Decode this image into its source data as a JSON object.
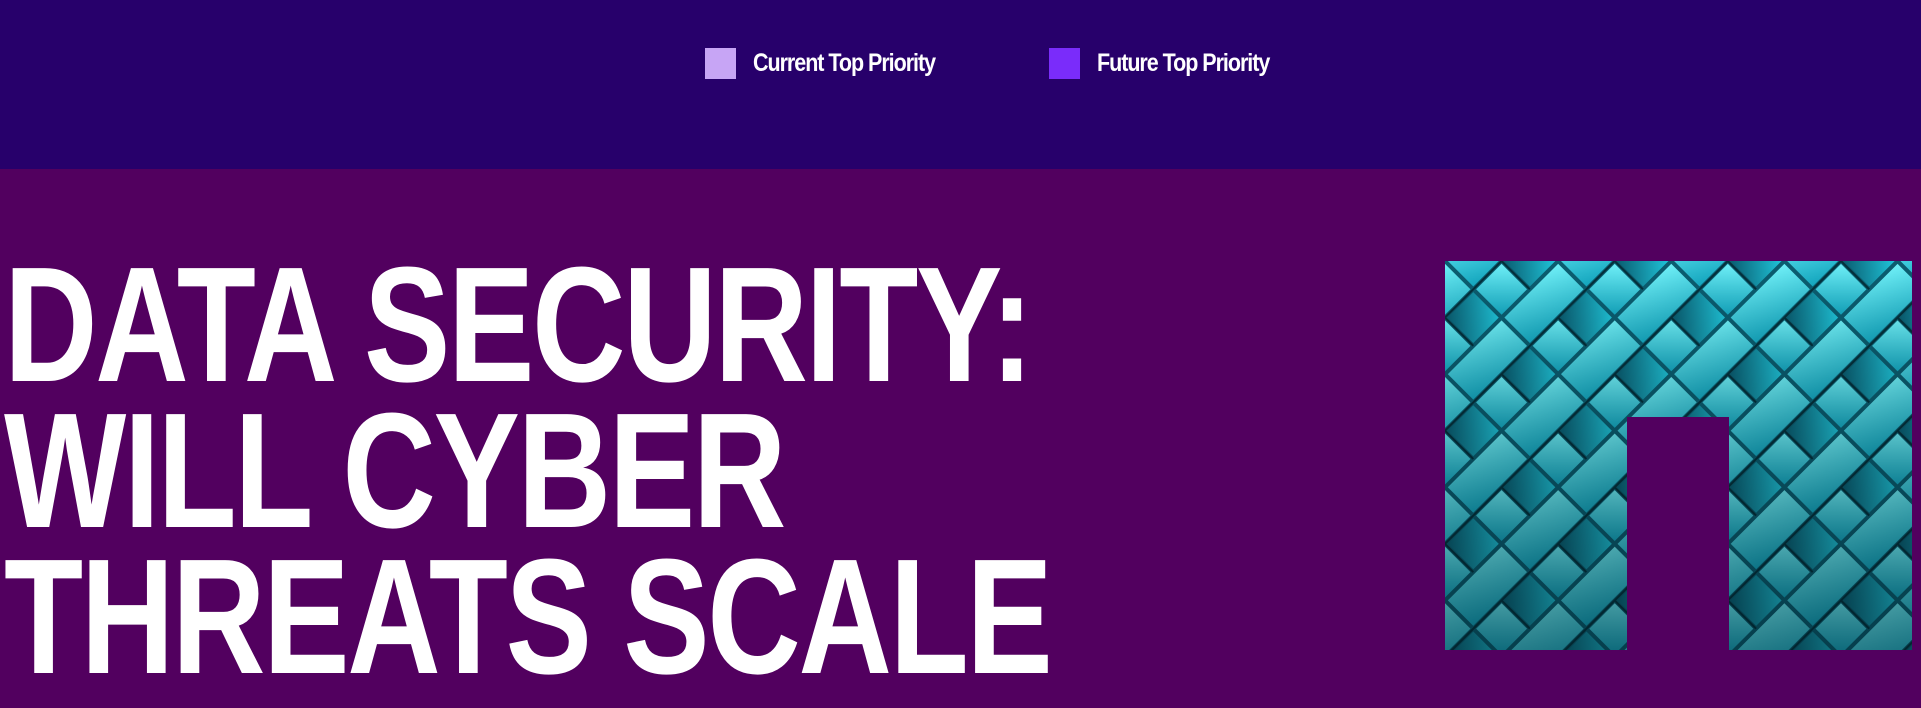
{
  "legend": {
    "items": [
      {
        "label": "Current Top Priority",
        "color": "#c7a5f5"
      },
      {
        "label": "Future Top Priority",
        "color": "#7a2cfa"
      }
    ]
  },
  "hero": {
    "line1": "DATA SECURITY:",
    "line2": "WILL CYBER",
    "line3": "THREATS SCALE"
  },
  "art": {
    "icon": "teal-diagonal-tile-logo",
    "colors": [
      "#15b6cc",
      "#5fe6f2",
      "#0b6f82"
    ]
  }
}
